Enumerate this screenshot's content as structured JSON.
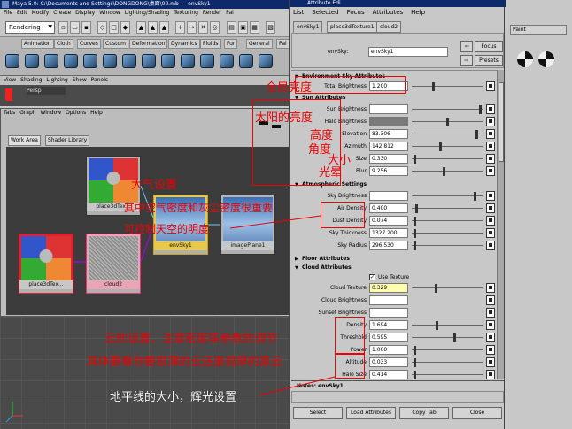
{
  "maya": {
    "title": "Maya 5.0: C:\\Documents and Settings\\DONGDONG\\桌面\\00.mb  ---  envSky1",
    "menu": "File Edit Modify Create Display Window Lighting/Shading Texturing Render Pai",
    "mode_dropdown": "Rendering",
    "shelf_tabs": [
      "Animation",
      "Cloth",
      "Curves",
      "Custom",
      "Deformation",
      "Dynamics",
      "Fluids",
      "Fur",
      "General",
      "Pai"
    ],
    "viewport_menu": "View Shading Lighting Show Panels",
    "viewport_label": "Persp"
  },
  "hypershade": {
    "menu": "Tabs Graph Window Options Help",
    "tabs": [
      "Work Area",
      "Shader Library"
    ],
    "nodes": {
      "place3d_top": "place3dTex...",
      "place3d_bottom": "place3dTex...",
      "cloud": "cloud2",
      "envsky": "envSky1",
      "imageplane": "imagePlane1"
    }
  },
  "attr_editor": {
    "title": "Attribute Edi",
    "menu": [
      "List",
      "Selected",
      "Focus",
      "Attributes",
      "Help"
    ],
    "tabs": [
      "envSky1",
      "place3dTexture1",
      "cloud2"
    ],
    "node_label": "envSky:",
    "node_value": "envSky1",
    "focus_btn": "Focus",
    "presets_btn": "Presets",
    "sections": {
      "env": "Environment Sky Attributes",
      "sun": "Sun Attributes",
      "atm": "Atmospheric Settings",
      "floor": "Floor Attributes",
      "cloud": "Cloud Attributes"
    },
    "total_brightness": {
      "label": "Total Brightness",
      "value": "1.200",
      "frac": 0.3
    },
    "sun_brightness": {
      "label": "Sun Brightness",
      "frac": 0.98
    },
    "halo_brightness": {
      "label": "Halo Brightness",
      "frac": 0.5
    },
    "elevation": {
      "label": "Elevation",
      "value": "83.306",
      "frac": 0.92
    },
    "azimuth": {
      "label": "Azimuth",
      "value": "142.812",
      "frac": 0.4
    },
    "size": {
      "label": "Size",
      "value": "0.330",
      "frac": 0.02
    },
    "blur": {
      "label": "Blur",
      "value": "9.256",
      "frac": 0.45
    },
    "sky_brightness": {
      "label": "Sky Brightness",
      "frac": 0.9
    },
    "air_density": {
      "label": "Air Density",
      "value": "0.400",
      "frac": 0.05
    },
    "dust_density": {
      "label": "Dust Density",
      "value": "0.074",
      "frac": 0.03
    },
    "sky_thickness": {
      "label": "Sky Thickness",
      "value": "1327.200",
      "frac": 0.03
    },
    "sky_radius": {
      "label": "Sky Radius",
      "value": "296.530",
      "frac": 0.03
    },
    "use_texture": "Use Texture",
    "cloud_texture": {
      "label": "Cloud Texture",
      "value": "0.329",
      "frac": 0.33
    },
    "cloud_brightness": {
      "label": "Cloud Brightness"
    },
    "sunset_brightness": {
      "label": "Sunset Brightness"
    },
    "density": {
      "label": "Density",
      "value": "1.694",
      "frac": 0.35
    },
    "threshold": {
      "label": "Threshold",
      "value": "0.595",
      "frac": 0.6
    },
    "power": {
      "label": "Power",
      "value": "1.000",
      "frac": 0.02
    },
    "altitude": {
      "label": "Altitude",
      "value": "0.033",
      "frac": 0.02
    },
    "halo_size": {
      "label": "Halo Size",
      "value": "0.414",
      "frac": 0.02
    },
    "notes_label": "Notes:  envSky1",
    "buttons": [
      "Select",
      "Load Attributes",
      "Copy Tab",
      "Close"
    ]
  },
  "annotations": {
    "total": "全局亮度",
    "sun": "太阳的亮度",
    "elev": "高度",
    "azim": "角度",
    "size": "大小",
    "blur": "光晕",
    "atm1": "大气设置",
    "atm2": "其中空气密度和灰尘密度很重要",
    "atm3": "可控制天空的明度",
    "cloud1": "云的设置，注意密度等参数的调节",
    "cloud2": "具体要看你要很薄的云还是很厚的黑云",
    "horizon": "地平线的大小，辉光设置"
  }
}
